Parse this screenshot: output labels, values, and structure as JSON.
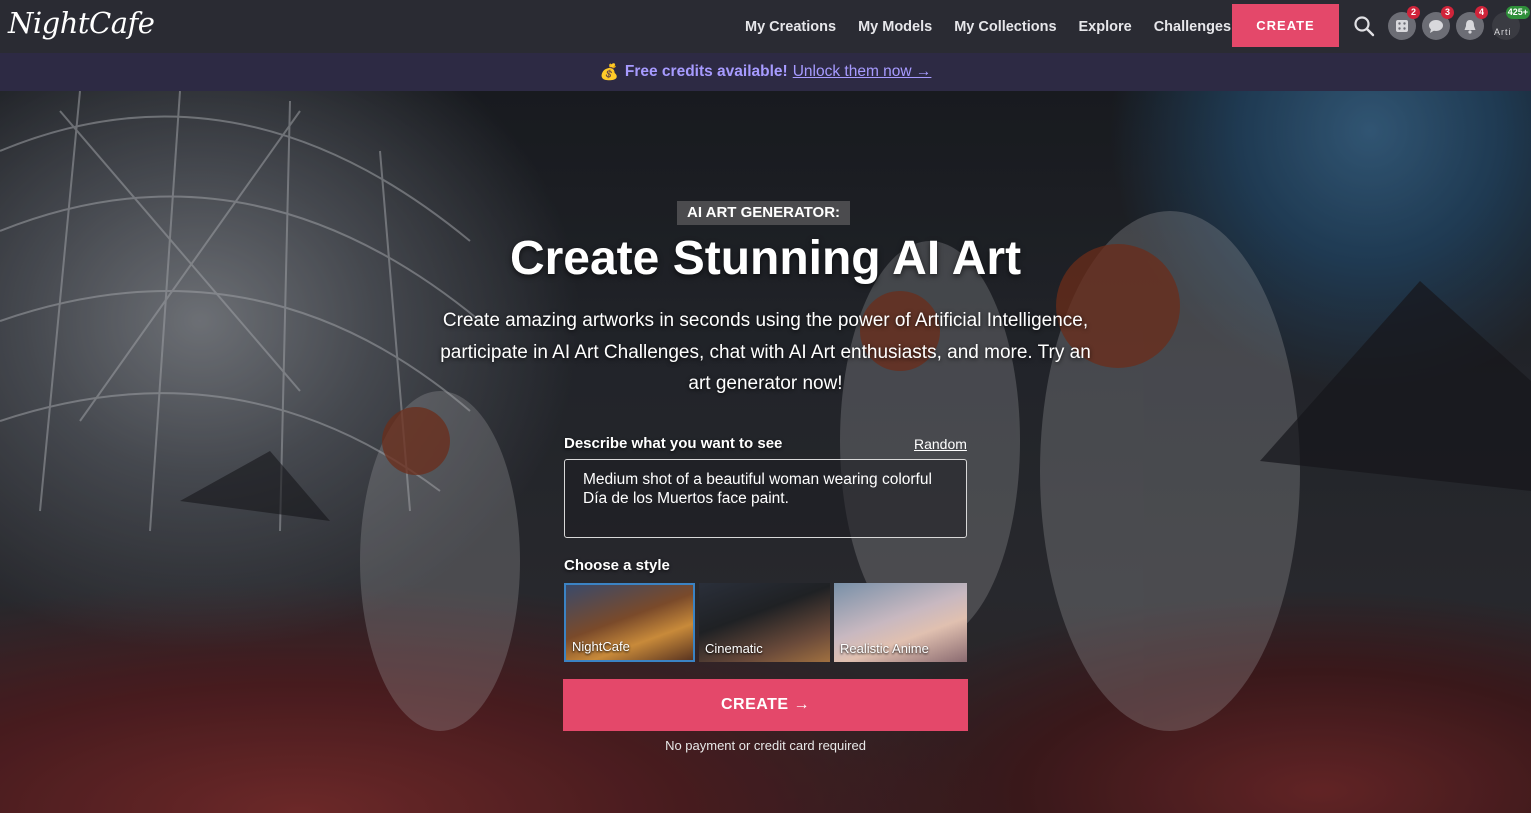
{
  "header": {
    "logo": "NightCafe",
    "nav": [
      "My Creations",
      "My Models",
      "My Collections",
      "Explore",
      "Challenges"
    ],
    "create_label": "CREATE",
    "icons": [
      {
        "name": "dice-icon",
        "badge": "2"
      },
      {
        "name": "chat-icon",
        "badge": "3"
      },
      {
        "name": "bell-icon",
        "badge": "4"
      },
      {
        "name": "avatar",
        "badge": "425+"
      }
    ],
    "avatar_text": "Arti"
  },
  "banner": {
    "icon": "💰",
    "free_text": "Free credits available!",
    "unlock_text": "Unlock them now →"
  },
  "hero": {
    "tag": "AI ART GENERATOR:",
    "title": "Create Stunning AI Art",
    "subtitle": "Create amazing artworks in seconds using the power of Artificial Intelligence, participate in AI Art Challenges, chat with AI Art enthusiasts, and more. Try an art generator now!",
    "describe_label": "Describe what you want to see",
    "random_label": "Random",
    "prompt_value": "Medium shot of a beautiful woman wearing colorful Día de los Muertos face paint.",
    "style_label": "Choose a style",
    "styles": [
      "NightCafe",
      "Cinematic",
      "Realistic Anime"
    ],
    "create_label": "CREATE →",
    "no_payment": "No payment or credit card required"
  },
  "colors": {
    "accent": "#e4486a",
    "banner_link": "#a79bff",
    "selected_style_border": "#3b83c4"
  }
}
